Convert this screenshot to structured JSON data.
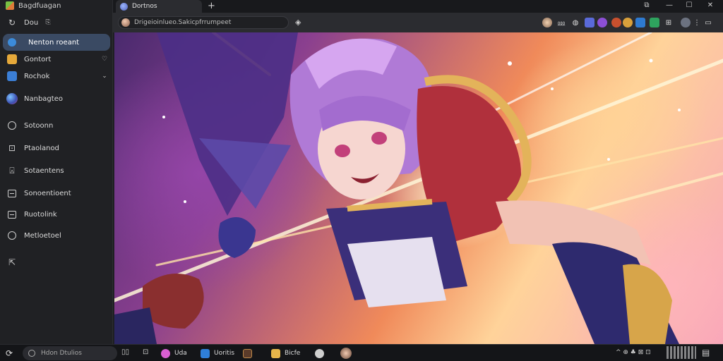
{
  "app": {
    "title": "Bagdfuagan"
  },
  "sidebar": {
    "items": [
      {
        "label": "Dou",
        "icon": "bolt-icon",
        "trail_icon": "copy-icon"
      },
      {
        "label": "Nenton roeant",
        "icon": "compass-icon",
        "active": true
      },
      {
        "label": "Gontort",
        "icon": "cube-icon",
        "trail": "♡"
      },
      {
        "label": "Rochok",
        "icon": "mail-icon",
        "trail": "⌄"
      },
      {
        "label": "Nanbagteo",
        "icon": "globe-icon"
      },
      {
        "label": "Sotoonn",
        "icon": "circle-icon"
      },
      {
        "label": "Ptaolanod",
        "icon": "book-icon"
      },
      {
        "label": "Sotaentens",
        "icon": "tag-icon"
      },
      {
        "label": "Sonoentioent",
        "icon": "window-icon"
      },
      {
        "label": "Ruotolink",
        "icon": "window-icon"
      },
      {
        "label": "Metloetoel",
        "icon": "clock-icon"
      },
      {
        "label": "",
        "icon": "share-icon"
      }
    ]
  },
  "tab": {
    "label": "Dortnos",
    "new_tab": "+"
  },
  "window": {
    "minimize": "—",
    "maximize": "☐",
    "close": "✕",
    "pin": "⧉"
  },
  "address": {
    "url": "Drigeioinlueo.Sakicpfrrumpeet"
  },
  "colors": {
    "accent": "#3a4a63",
    "sidebar_bg": "#202124",
    "taskbar_bg": "#141518"
  },
  "taskbar": {
    "start_icon": "start-icon",
    "search_placeholder": "Hdon Dtulios",
    "apps": [
      {
        "label": "Uda",
        "color": "#d95fd2"
      },
      {
        "label": "Uoritis",
        "color": "#2f7fd9"
      },
      {
        "label": "",
        "color": "#5a3b2a"
      },
      {
        "label": "Bicfe",
        "color": "#e6b54a"
      },
      {
        "label": "",
        "color": "#cfcfcf"
      }
    ],
    "tray_text": "^ ⊕ ♣ ⊠ ⊡"
  }
}
